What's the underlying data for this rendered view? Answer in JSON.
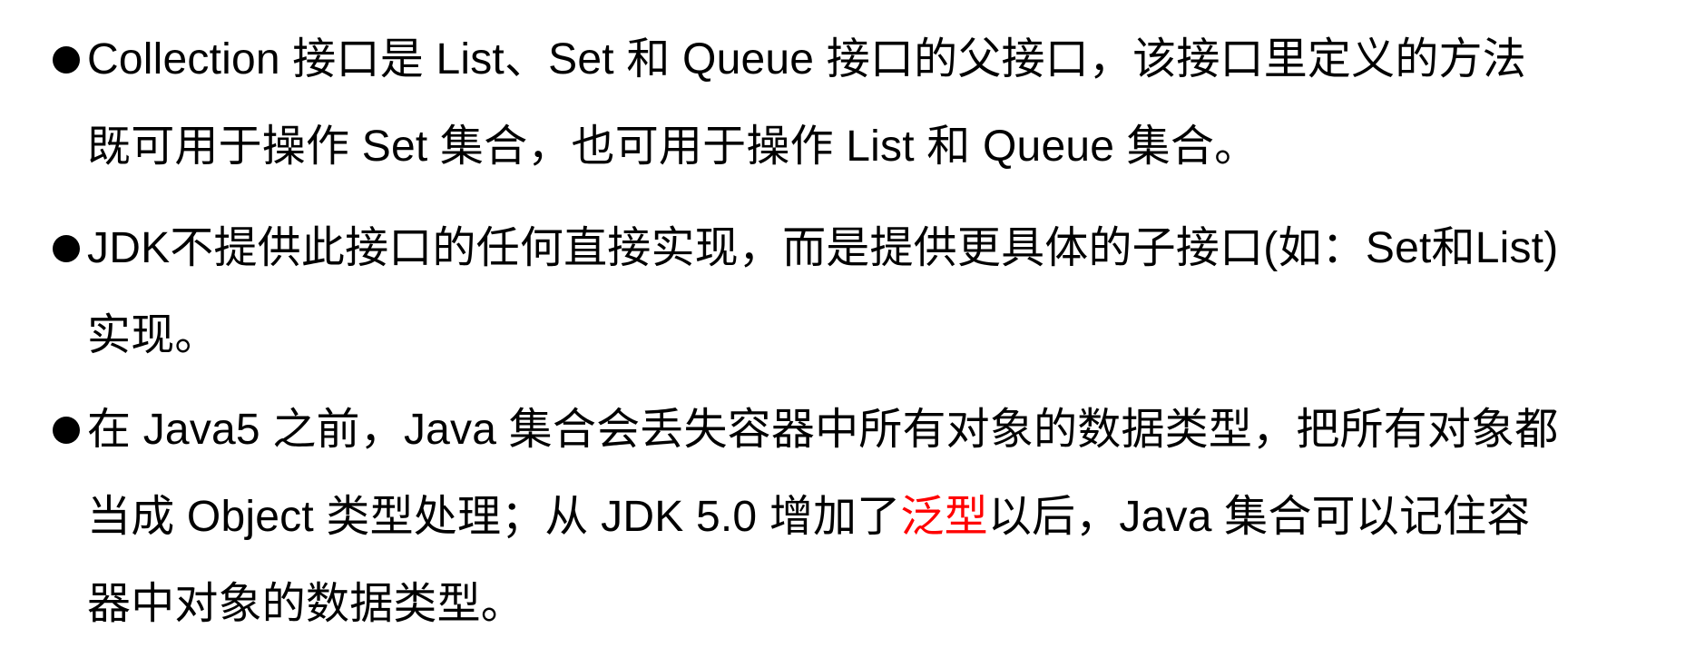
{
  "bullets": [
    {
      "lines": [
        "Collection 接口是 List、Set 和 Queue 接口的父接口，该接口里定义的方法",
        "既可用于操作 Set 集合，也可用于操作 List 和 Queue 集合。"
      ]
    },
    {
      "lines": [
        "JDK不提供此接口的任何直接实现，而是提供更具体的子接口(如：Set和List)",
        "实现。"
      ]
    },
    {
      "line1": "在 Java5 之前，Java 集合会丢失容器中所有对象的数据类型，把所有对象都",
      "line2_before": "当成 Object 类型处理；从 JDK 5.0 增加了",
      "line2_highlight": "泛型",
      "line2_after": "以后，Java 集合可以记住容",
      "line3": "器中对象的数据类型。"
    }
  ],
  "colors": {
    "text": "#000000",
    "highlight": "#ff0000",
    "background": "#ffffff"
  }
}
